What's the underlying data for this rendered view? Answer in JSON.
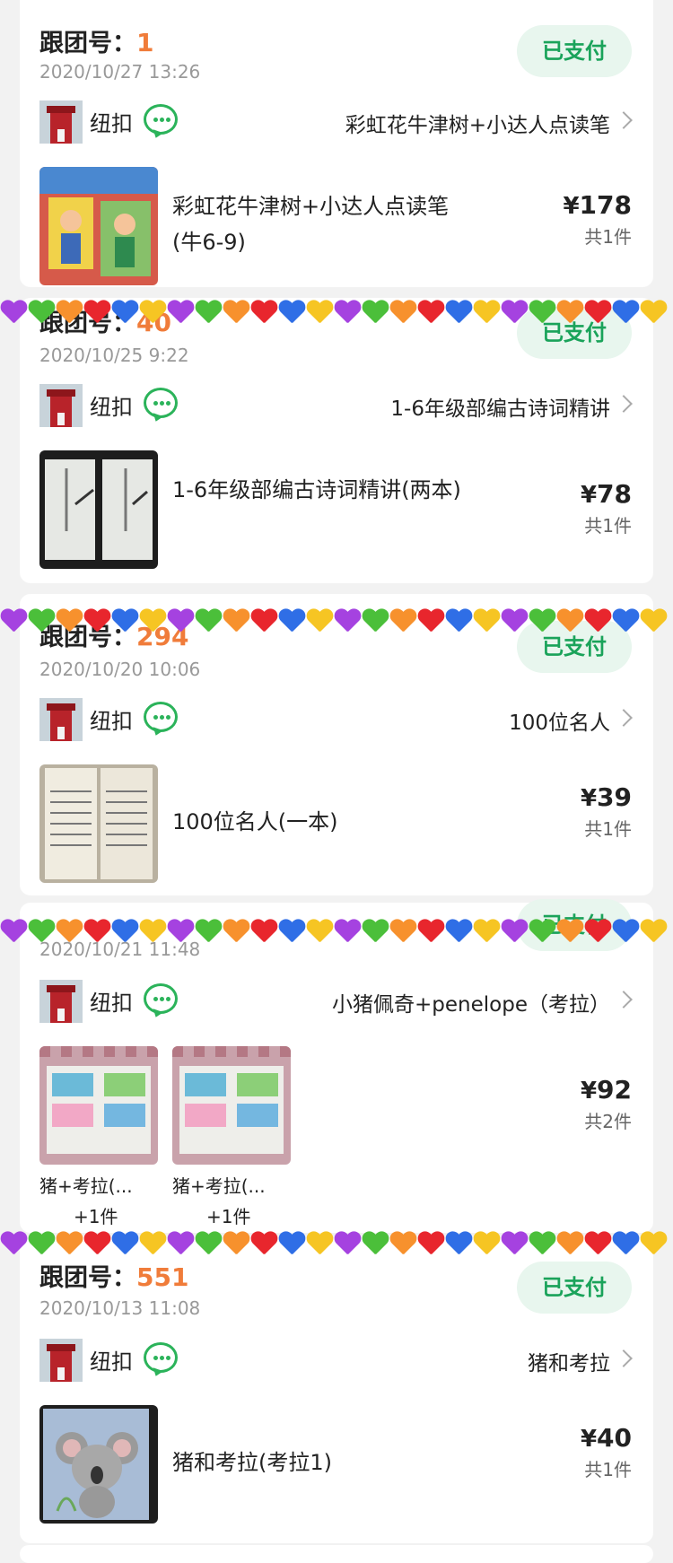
{
  "orders": [
    {
      "group_label": "跟团号：",
      "group_number": "1",
      "date": "2020/10/27 13:26",
      "status": "已支付",
      "seller": "纽扣",
      "product_link": "彩虹花牛津树+小达人点读笔",
      "items": [
        {
          "title": "彩虹花牛津树+小达人点读笔(牛6-9)"
        }
      ],
      "price": "178",
      "count": "共1件"
    },
    {
      "group_label": "跟团号：",
      "group_number": "40",
      "date": "2020/10/25 9:22",
      "status": "已支付",
      "seller": "纽扣",
      "product_link": "1-6年级部编古诗词精讲",
      "items": [
        {
          "title": "1-6年级部编古诗词精讲(两本)"
        }
      ],
      "price": "78",
      "count": "共1件"
    },
    {
      "group_label": "跟团号：",
      "group_number": "294",
      "date": "2020/10/20 10:06",
      "status": "已支付",
      "seller": "纽扣",
      "product_link": "100位名人",
      "items": [
        {
          "title": "100位名人(一本)"
        }
      ],
      "price": "39",
      "count": "共1件"
    },
    {
      "date": "2020/10/21 11:48",
      "status": "已支付",
      "seller": "纽扣",
      "product_link": "小猪佩奇+penelope（考拉）",
      "items": [
        {
          "caption": "猪+考拉(...",
          "extra": "+1件"
        },
        {
          "caption": "猪+考拉(...",
          "extra": "+1件"
        }
      ],
      "price": "92",
      "count": "共2件"
    },
    {
      "group_label": "跟团号：",
      "group_number": "551",
      "date": "2020/10/13 11:08",
      "status": "已支付",
      "seller": "纽扣",
      "product_link": "猪和考拉",
      "items": [
        {
          "title": "猪和考拉(考拉1)"
        }
      ],
      "price": "40",
      "count": "共1件"
    }
  ],
  "currency": "¥",
  "heart_colors": [
    "#a542e0",
    "#4bbf3a",
    "#f7912d",
    "#e8262d",
    "#2f6ee6",
    "#f6c523"
  ],
  "colors": {
    "accent_green": "#1aa35a",
    "group_number": "#f07c3a",
    "paid_bg": "#e8f6ee"
  }
}
